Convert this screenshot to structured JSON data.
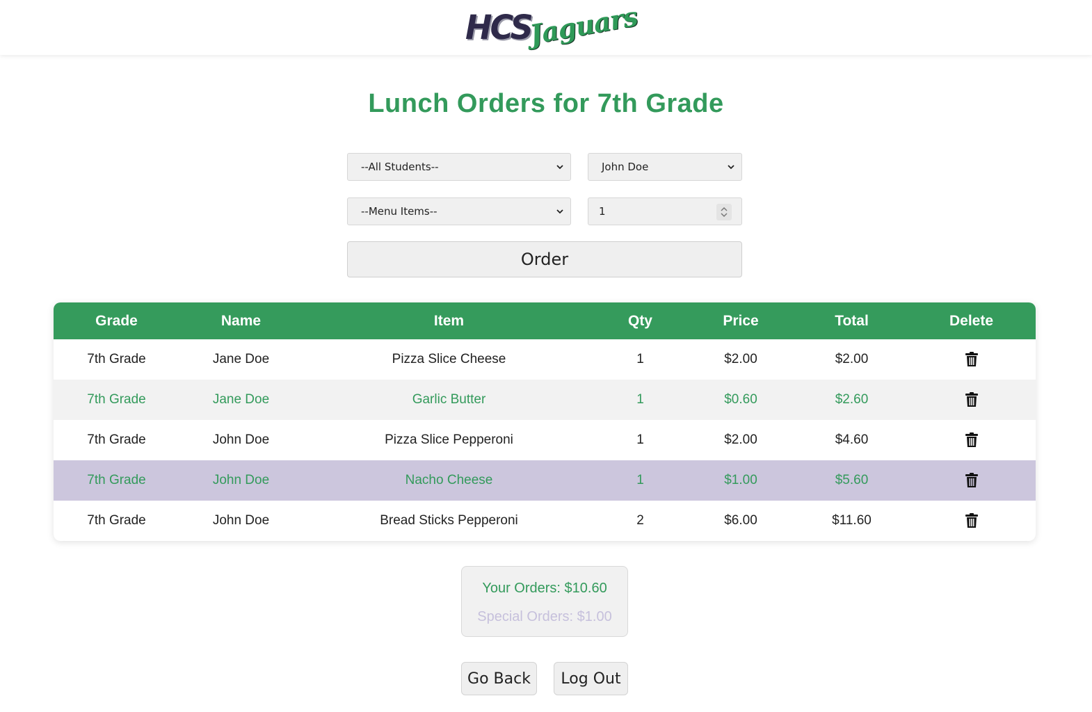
{
  "header": {
    "logo_text_primary": "HCS",
    "logo_text_secondary": "Jaguars"
  },
  "page_title": "Lunch Orders for 7th Grade",
  "filters": {
    "student_filter": "--All Students--",
    "student_select": "John Doe",
    "menu_items": "--Menu Items--",
    "quantity": "1"
  },
  "order_button": "Order",
  "table": {
    "headers": [
      "Grade",
      "Name",
      "Item",
      "Qty",
      "Price",
      "Total",
      "Delete"
    ],
    "rows": [
      {
        "grade": "7th Grade",
        "name": "Jane Doe",
        "item": "Pizza Slice Cheese",
        "qty": "1",
        "price": "$2.00",
        "total": "$2.00"
      },
      {
        "grade": "7th Grade",
        "name": "Jane Doe",
        "item": "Garlic Butter",
        "qty": "1",
        "price": "$0.60",
        "total": "$2.60"
      },
      {
        "grade": "7th Grade",
        "name": "John Doe",
        "item": "Pizza Slice Pepperoni",
        "qty": "1",
        "price": "$2.00",
        "total": "$4.60"
      },
      {
        "grade": "7th Grade",
        "name": "John Doe",
        "item": "Nacho Cheese",
        "qty": "1",
        "price": "$1.00",
        "total": "$5.60"
      },
      {
        "grade": "7th Grade",
        "name": "John Doe",
        "item": "Bread Sticks Pepperoni",
        "qty": "2",
        "price": "$6.00",
        "total": "$11.60"
      }
    ]
  },
  "summary": {
    "your_orders": "Your Orders: $10.60",
    "special_orders": "Special Orders: $1.00"
  },
  "buttons": {
    "go_back": "Go Back",
    "log_out": "Log Out"
  },
  "colors": {
    "accent_green": "#359b5c",
    "special_row": "#ccc6dd",
    "navy": "#2f2a4a"
  },
  "icons": {
    "delete": "trash-icon",
    "select": "chevron-down-icon",
    "spinner": "spinner-icon"
  }
}
